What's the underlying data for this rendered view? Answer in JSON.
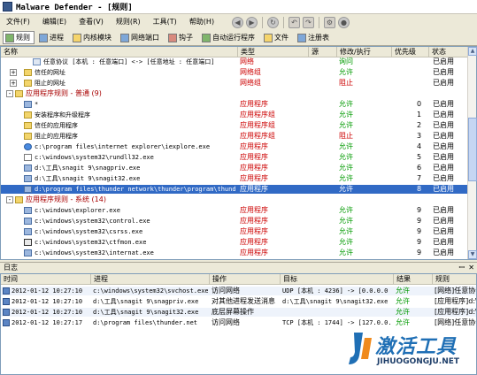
{
  "window": {
    "title": "Malware Defender - [规则]"
  },
  "menu": [
    "文件(F)",
    "编辑(E)",
    "查看(V)",
    "规则(R)",
    "工具(T)",
    "帮助(H)"
  ],
  "nav_icons": [
    "back-icon",
    "forward-icon",
    "refresh-icon",
    "undo-icon",
    "redo-icon",
    "settings-icon",
    "stop-icon"
  ],
  "tabs": [
    {
      "label": "规则",
      "icon": "rules-icon",
      "active": true
    },
    {
      "label": "进程",
      "icon": "process-icon"
    },
    {
      "label": "内核模块",
      "icon": "kernel-module-icon"
    },
    {
      "label": "网络端口",
      "icon": "network-port-icon"
    },
    {
      "label": "钩子",
      "icon": "hook-icon"
    },
    {
      "label": "自动运行程序",
      "icon": "autorun-icon"
    },
    {
      "label": "文件",
      "icon": "file-icon"
    },
    {
      "label": "注册表",
      "icon": "registry-icon"
    }
  ],
  "rules_table": {
    "headers": [
      "名称",
      "类型",
      "源",
      "修改/执行",
      "优先级",
      "状态"
    ],
    "rows": [
      {
        "indent": 2,
        "icon": "net",
        "name": "任意协议 [本机 : 任意端口] <-> [任意地址 : 任意端口]",
        "type": "网络",
        "action": "询问",
        "action_kind": "ask",
        "priority": "",
        "status": "已启用"
      },
      {
        "indent": 1,
        "expander": "+",
        "icon": "folder",
        "name": "信任的网址",
        "type": "网络组",
        "action": "允许",
        "action_kind": "allow",
        "priority": "",
        "status": "已启用"
      },
      {
        "indent": 1,
        "expander": "+",
        "icon": "folder",
        "name": "阻止的网址",
        "type": "网络组",
        "action": "阻止",
        "action_kind": "block",
        "priority": "",
        "status": "已启用"
      },
      {
        "indent": 0,
        "expander": "-",
        "icon": "folder",
        "name": "应用程序规则 - 普通 (9)",
        "group": true
      },
      {
        "indent": 1,
        "icon": "app",
        "name": "*",
        "type": "应用程序",
        "action": "允许",
        "action_kind": "allow",
        "priority": "0",
        "status": "已启用"
      },
      {
        "indent": 1,
        "icon": "folder",
        "name": "安装程序和升级程序",
        "type": "应用程序组",
        "action": "允许",
        "action_kind": "allow",
        "priority": "1",
        "status": "已启用"
      },
      {
        "indent": 1,
        "icon": "folder",
        "name": "信任的应用程序",
        "type": "应用程序组",
        "action": "允许",
        "action_kind": "allow",
        "priority": "2",
        "status": "已启用"
      },
      {
        "indent": 1,
        "icon": "folder",
        "name": "阻止的应用程序",
        "type": "应用程序组",
        "action": "阻止",
        "action_kind": "block",
        "priority": "3",
        "status": "已启用"
      },
      {
        "indent": 1,
        "icon": "ie",
        "name": "c:\\program files\\internet explorer\\iexplore.exe",
        "type": "应用程序",
        "action": "允许",
        "action_kind": "allow",
        "priority": "4",
        "status": "已启用"
      },
      {
        "indent": 1,
        "icon": "file",
        "name": "c:\\windows\\system32\\rundll32.exe",
        "type": "应用程序",
        "action": "允许",
        "action_kind": "allow",
        "priority": "5",
        "status": "已启用"
      },
      {
        "indent": 1,
        "icon": "app",
        "name": "d:\\工具\\snagit 9\\snagpriv.exe",
        "type": "应用程序",
        "action": "允许",
        "action_kind": "allow",
        "priority": "6",
        "status": "已启用"
      },
      {
        "indent": 1,
        "icon": "app",
        "name": "d:\\工具\\snagit 9\\snagit32.exe",
        "type": "应用程序",
        "action": "允许",
        "action_kind": "allow",
        "priority": "7",
        "status": "已启用"
      },
      {
        "indent": 1,
        "icon": "app",
        "name": "d:\\program files\\thunder network\\thunder\\program\\thund...",
        "type": "应用程序",
        "action": "允许",
        "action_kind": "allow",
        "priority": "8",
        "status": "已启用",
        "selected": true
      },
      {
        "indent": 0,
        "expander": "-",
        "icon": "folder",
        "name": "应用程序规则 - 系统 (14)",
        "group": true
      },
      {
        "indent": 1,
        "icon": "app",
        "name": "c:\\windows\\explorer.exe",
        "type": "应用程序",
        "action": "允许",
        "action_kind": "allow",
        "priority": "9",
        "status": "已启用"
      },
      {
        "indent": 1,
        "icon": "app",
        "name": "c:\\windows\\system32\\control.exe",
        "type": "应用程序",
        "action": "允许",
        "action_kind": "allow",
        "priority": "9",
        "status": "已启用"
      },
      {
        "indent": 1,
        "icon": "app",
        "name": "c:\\windows\\system32\\csrss.exe",
        "type": "应用程序",
        "action": "允许",
        "action_kind": "allow",
        "priority": "9",
        "status": "已启用"
      },
      {
        "indent": 1,
        "icon": "pen",
        "name": "c:\\windows\\system32\\ctfmon.exe",
        "type": "应用程序",
        "action": "允许",
        "action_kind": "allow",
        "priority": "9",
        "status": "已启用"
      },
      {
        "indent": 1,
        "icon": "app",
        "name": "c:\\windows\\system32\\internat.exe",
        "type": "应用程序",
        "action": "允许",
        "action_kind": "allow",
        "priority": "9",
        "status": "已启用"
      }
    ]
  },
  "log": {
    "title": "日志",
    "headers": [
      "时间",
      "进程",
      "操作",
      "目标",
      "结果",
      "规则"
    ],
    "rows": [
      {
        "time": "2012-01-12 10:27:10",
        "process": "c:\\windows\\system32\\svchost.exe",
        "op": "访问网络",
        "target": "UDP [本机 : 4236] -> [0.0.0.0 : 0]",
        "result": "允许",
        "rule": "[网络]任意协议"
      },
      {
        "time": "2012-01-12 10:27:10",
        "process": "d:\\工具\\snagit 9\\snagpriv.exe",
        "op": "对其他进程发送消息",
        "target": "d:\\工具\\snagit 9\\snagit32.exe",
        "result": "允许",
        "rule": "[应用程序]d:\\"
      },
      {
        "time": "2012-01-12 10:27:10",
        "process": "d:\\工具\\snagit 9\\snagit32.exe",
        "op": "底层屏幕操作",
        "target": "",
        "result": "允许",
        "rule": "[应用程序]d:\\"
      },
      {
        "time": "2012-01-12 10:27:17",
        "process": "d:\\program files\\thunder.net",
        "op": "访问网络",
        "target": "TCP [本机 : 1744] -> [127.0.0.1 : 5",
        "result": "允许",
        "rule": "[网络]任意协议"
      }
    ]
  },
  "watermark": {
    "cn": "激活工具",
    "en": "JIHUOGONGJU.NET"
  },
  "colors": {
    "selection": "#316ac5",
    "allow": "#009a00",
    "block": "#cc0000",
    "pane_border": "#7f9db9"
  }
}
